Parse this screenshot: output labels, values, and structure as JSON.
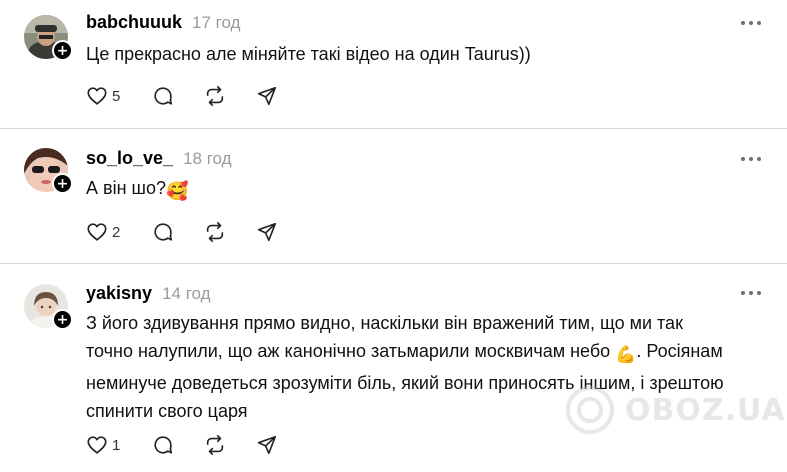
{
  "posts": [
    {
      "username": "babchuuuk",
      "time": "17 год",
      "text": "Це прекрасно але міняйте такі відео на один Taurus))",
      "likes": "5",
      "avatar": "avatar-man-hat"
    },
    {
      "username": "so_lo_ve_",
      "time": "18 год",
      "text": "А він шо?",
      "emoji": "🥰",
      "likes": "2",
      "avatar": "avatar-woman-sunglasses"
    },
    {
      "username": "yakisny",
      "time": "14 год",
      "text_lines": [
        "З його здивування прямо видно, наскільки він вражений тим, що ми так",
        "точно налупили, що аж канонічно затьмарили москвичам небо",
        ". Росіянам",
        "неминуче доведеться зрозуміти біль, який вони приносять іншим, і зрештою",
        "спинити свого царя"
      ],
      "emoji": "💪",
      "likes": "1",
      "avatar": "avatar-young-person"
    }
  ],
  "follow_badge": "+",
  "watermark": "OBOZ.UA",
  "icons": {
    "like": "heart-icon",
    "reply": "comment-icon",
    "repost": "repost-icon",
    "share": "send-icon",
    "more": "more-icon"
  }
}
